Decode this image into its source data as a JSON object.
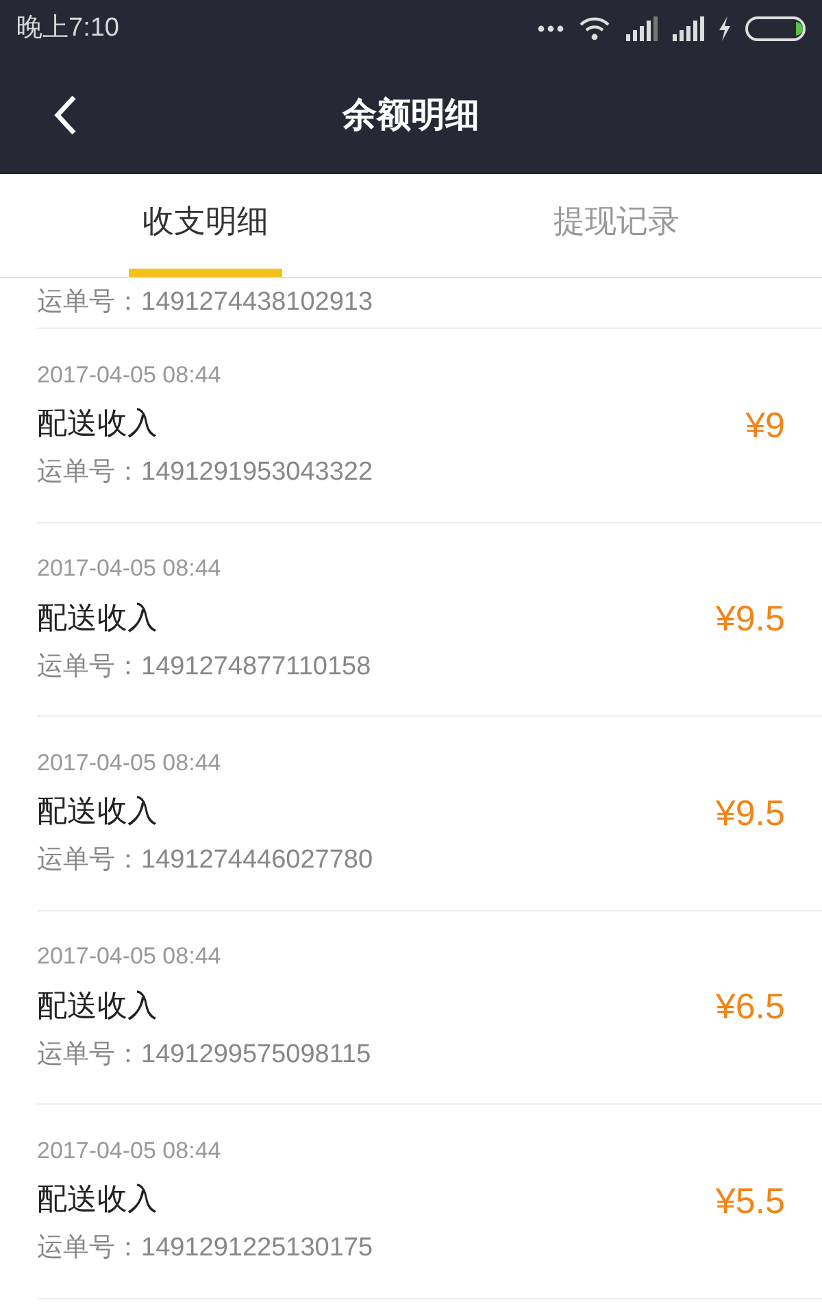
{
  "status_bar": {
    "time": "晚上7:10"
  },
  "header": {
    "title": "余额明细"
  },
  "tabs": [
    {
      "label": "收支明细",
      "selected": true
    },
    {
      "label": "提现记录",
      "selected": false
    }
  ],
  "partial_order": "运单号：1491274438102913",
  "records": [
    {
      "date": "2017-04-05 08:44",
      "title": "配送收入",
      "order": "运单号：1491291953043322",
      "amount": "¥9"
    },
    {
      "date": "2017-04-05 08:44",
      "title": "配送收入",
      "order": "运单号：1491274877110158",
      "amount": "¥9.5"
    },
    {
      "date": "2017-04-05 08:44",
      "title": "配送收入",
      "order": "运单号：1491274446027780",
      "amount": "¥9.5"
    },
    {
      "date": "2017-04-05 08:44",
      "title": "配送收入",
      "order": "运单号：1491299575098115",
      "amount": "¥6.5"
    },
    {
      "date": "2017-04-05 08:44",
      "title": "配送收入",
      "order": "运单号：1491291225130175",
      "amount": "¥5.5"
    }
  ]
}
